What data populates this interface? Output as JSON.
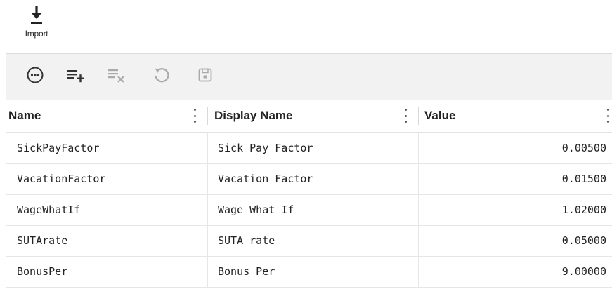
{
  "import": {
    "label": "Import",
    "icon": "download-icon"
  },
  "toolbar": {
    "tools": [
      {
        "name": "more-options-icon",
        "enabled": true
      },
      {
        "name": "add-row-icon",
        "enabled": true
      },
      {
        "name": "delete-row-icon",
        "enabled": false
      },
      {
        "name": "undo-icon",
        "enabled": false
      },
      {
        "name": "save-icon",
        "enabled": false
      }
    ]
  },
  "grid": {
    "columns": [
      "Name",
      "Display Name",
      "Value"
    ],
    "rows": [
      {
        "name": "SickPayFactor",
        "display": "Sick Pay Factor",
        "value": "0.00500"
      },
      {
        "name": "VacationFactor",
        "display": "Vacation Factor",
        "value": "0.01500"
      },
      {
        "name": "WageWhatIf",
        "display": "Wage What If",
        "value": "1.02000"
      },
      {
        "name": "SUTArate",
        "display": "SUTA rate",
        "value": "0.05000"
      },
      {
        "name": "BonusPer",
        "display": "Bonus Per",
        "value": "9.00000"
      }
    ]
  },
  "colors": {
    "toolbar_bg": "#f2f2f2",
    "icon_enabled": "#333333",
    "icon_disabled": "#aaaaaa"
  }
}
